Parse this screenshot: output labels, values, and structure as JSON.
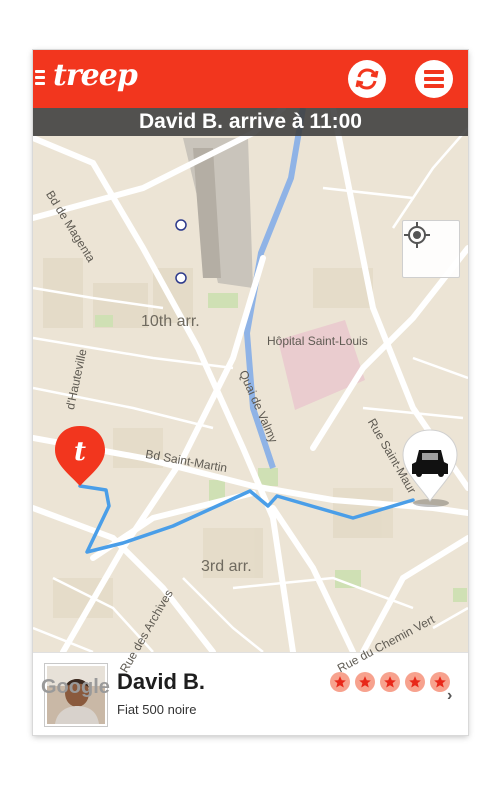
{
  "app": {
    "logo": "treep",
    "brand_color": "#f2361e"
  },
  "banner": {
    "text": "David B. arrive à 11:00"
  },
  "map": {
    "labels": {
      "bd_magenta": "Bd de Magenta",
      "arr10": "10th arr.",
      "hopital": "Hôpital Saint-Louis",
      "hauteville": "d'Hauteville",
      "valmy": "Quai de Valmy",
      "bd_saint_martin": "Bd Saint-Martin",
      "rue_saint": "Rue Saint-Maur",
      "arr3": "3rd arr.",
      "archives": "Rue des Archives",
      "chemin_vert": "Rue du Chemin Vert"
    },
    "attribution": "Google",
    "route_color": "#4a9ee8"
  },
  "driver": {
    "name": "David B.",
    "car": "Fiat 500 noire",
    "rating": 5
  },
  "icons": {
    "sync": "sync-icon",
    "menu": "menu-icon",
    "locate": "locate-icon",
    "car": "car-icon",
    "pin": "treep-pin-icon"
  }
}
